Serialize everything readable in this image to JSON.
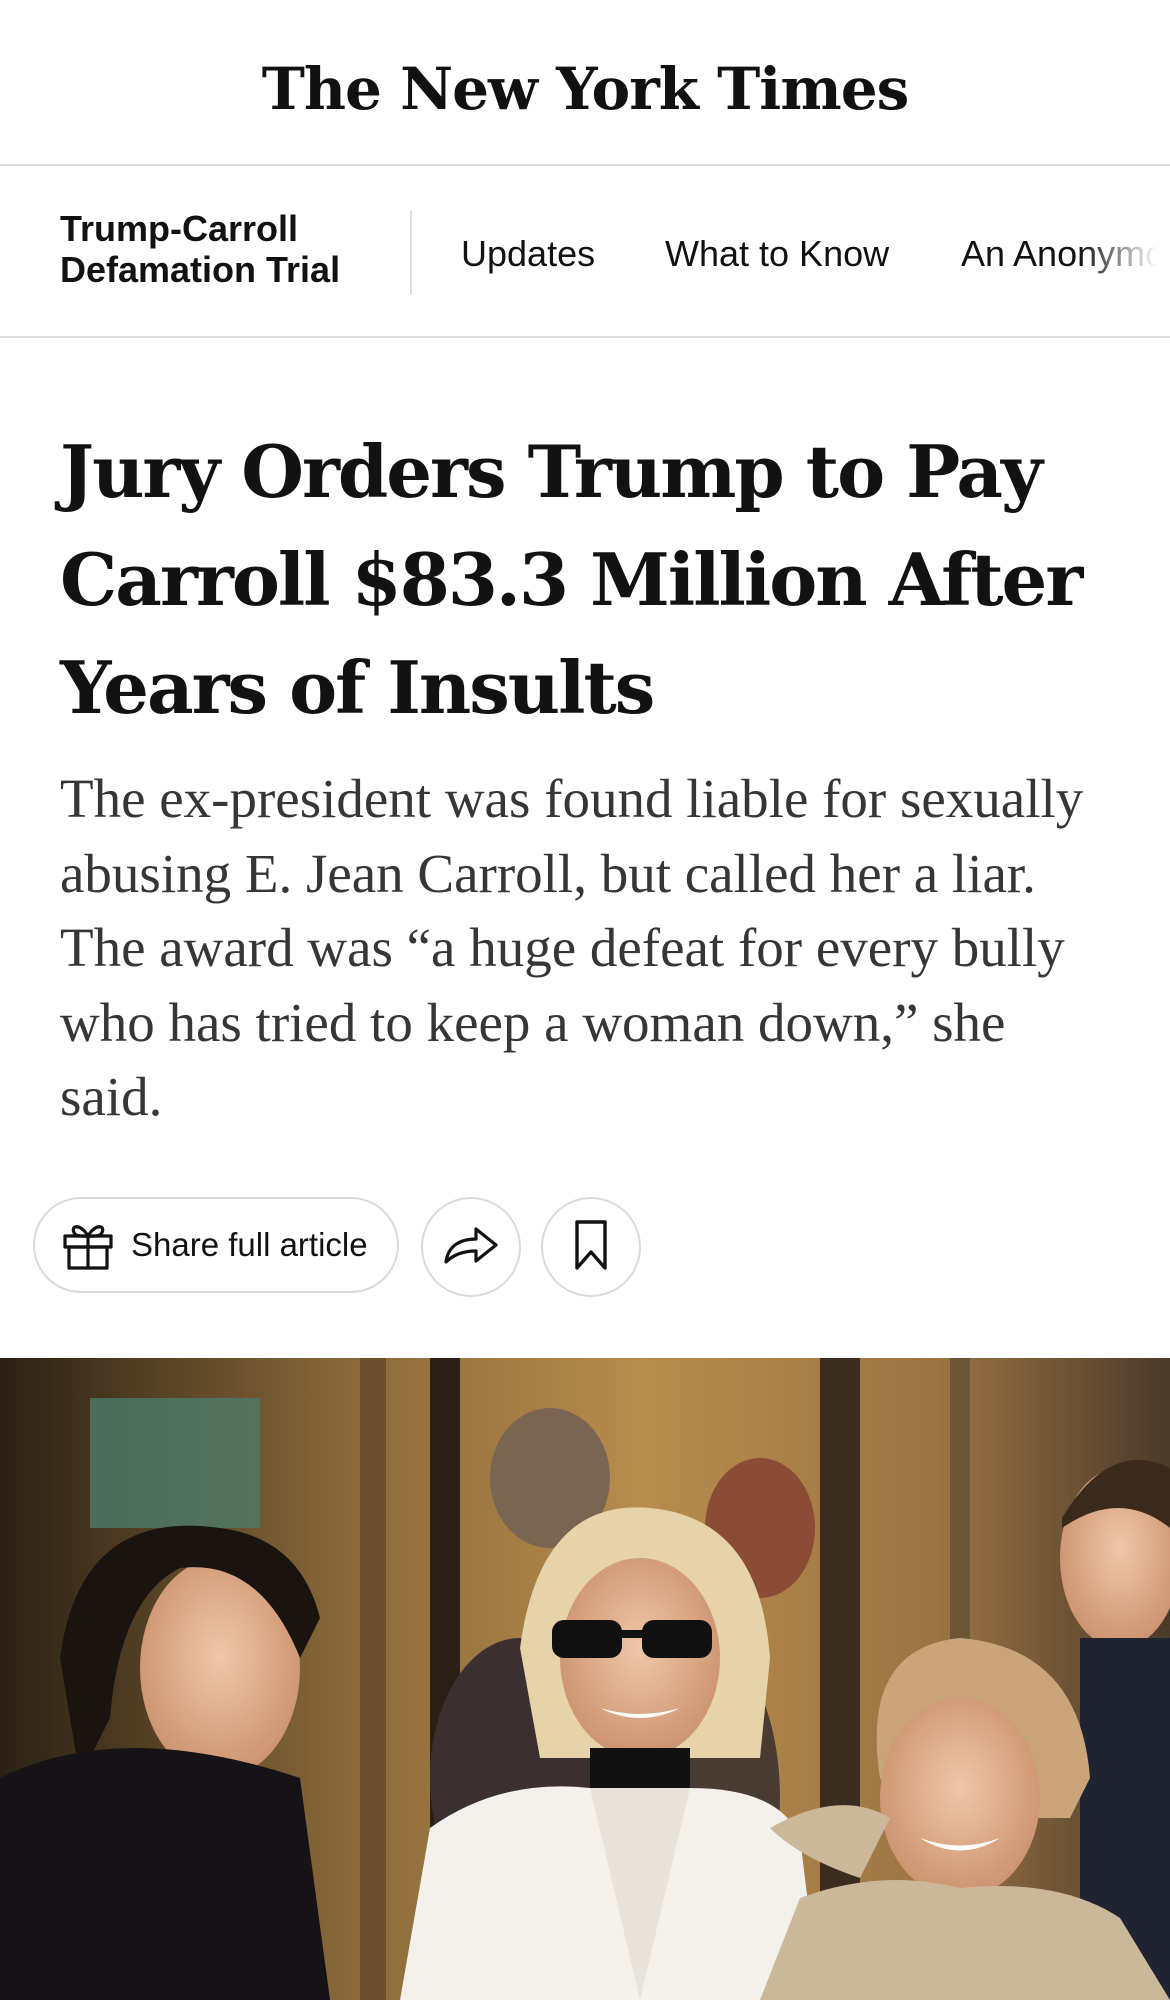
{
  "masthead": {
    "title": "The New York Times"
  },
  "section_nav": {
    "section_title_line1": "Trump-Carroll",
    "section_title_line2": "Defamation Trial",
    "links": [
      {
        "label": "Updates"
      },
      {
        "label": "What to Know"
      },
      {
        "label": "An Anonymo"
      }
    ]
  },
  "article": {
    "headline": "Jury Orders Trump to Pay Carroll $83.3 Million After Years of Insults",
    "summary": "The ex-president was found liable for sexually abusing E. Jean Carroll, but called her a liar. The award was “a huge defeat for every bully who has tried to keep a woman down,” she said."
  },
  "actions": {
    "share_label": "Share full article",
    "icons": {
      "share": "gift-icon",
      "forward": "forward-arrow-icon",
      "bookmark": "bookmark-icon"
    }
  },
  "colors": {
    "text": "#121212",
    "summary_text": "#363636",
    "divider": "#dcdcdc",
    "button_border": "#dadada"
  }
}
